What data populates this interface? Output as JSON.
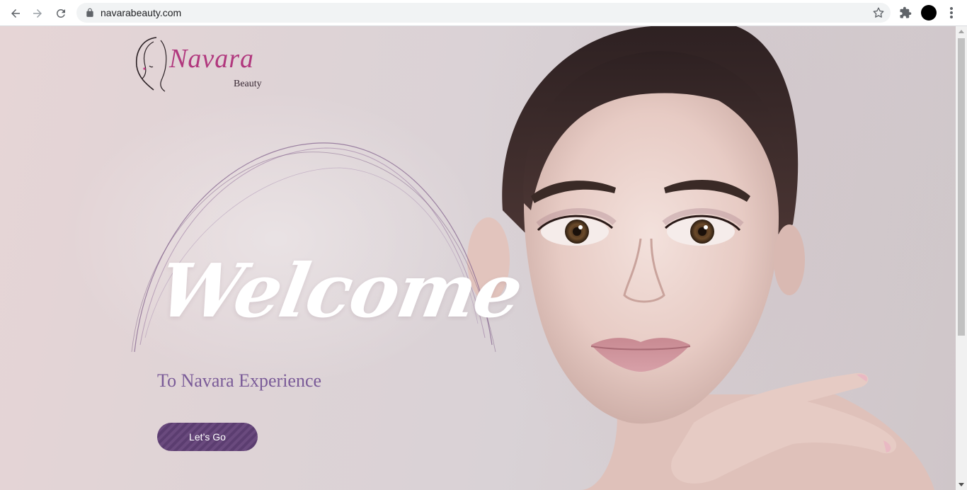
{
  "browser": {
    "url": "navarabeauty.com",
    "colors": {
      "toolbar": "#ffffff",
      "omnibox": "#f1f3f4",
      "icon": "#5f6368"
    },
    "icons": [
      "back-arrow-icon",
      "forward-arrow-icon",
      "reload-icon",
      "lock-icon",
      "star-icon",
      "extensions-icon",
      "menu-icon"
    ]
  },
  "logo": {
    "script": "Navara",
    "sub": "Beauty",
    "color": "#b1387e"
  },
  "hero": {
    "heading": "Welcome",
    "subtitle": "To Navara Experience",
    "cta_label": "Let’s Go",
    "colors": {
      "subtitle": "#7a5b98",
      "cta": "#5b3d70"
    }
  }
}
